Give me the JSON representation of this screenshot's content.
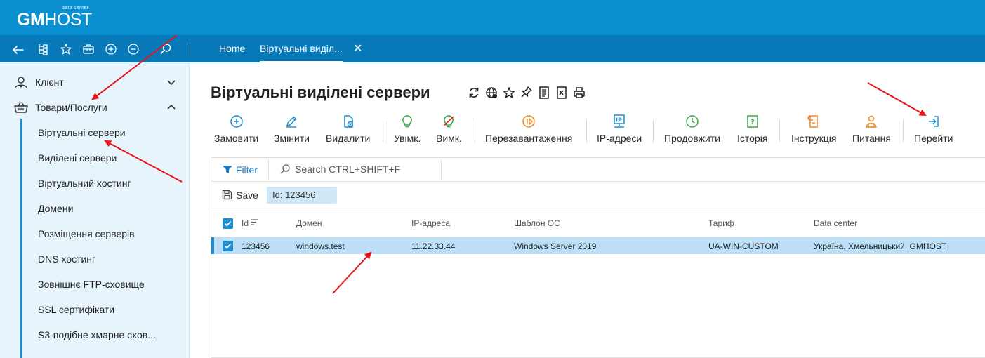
{
  "brand": {
    "logo_bold": "GM",
    "logo_light": "HOST",
    "tagline": "data center"
  },
  "navbar": {
    "icons": [
      "back-arrow-icon",
      "tree-icon",
      "star-icon",
      "briefcase-icon",
      "plus-circle-icon",
      "minus-circle-icon",
      "search-icon"
    ],
    "tabs": [
      {
        "label": "Home"
      },
      {
        "label": "Віртуальні виділ..."
      }
    ],
    "close_label": "✕"
  },
  "sidebar": {
    "groups": [
      {
        "label": "Клієнт",
        "icon": "user-icon",
        "expanded": false
      },
      {
        "label": "Товари/Послуги",
        "icon": "basket-icon",
        "expanded": true
      }
    ],
    "items": [
      "Віртуальні сервери",
      "Виділені сервери",
      "Віртуальний хостинг",
      "Домени",
      "Розміщення серверів",
      "DNS хостинг",
      "Зовнішнє FTP-сховище",
      "SSL сертифікати",
      "S3-подібне хмарне схов..."
    ]
  },
  "page": {
    "title": "Віртуальні виділені сервери",
    "title_icons": [
      "refresh-icon",
      "globe-icon",
      "star-icon",
      "pin-icon",
      "document-icon",
      "excel-icon",
      "print-icon"
    ]
  },
  "toolbar": [
    {
      "label": "Замовити",
      "icon": "plus-circle-icon",
      "color": "#1d8fd1"
    },
    {
      "label": "Змінити",
      "icon": "pencil-icon",
      "color": "#1d8fd1"
    },
    {
      "label": "Видалити",
      "icon": "delete-doc-icon",
      "color": "#1d8fd1"
    },
    {
      "label": "Увімк.",
      "icon": "bulb-on-icon",
      "color": "#3aa647"
    },
    {
      "label": "Вимк.",
      "icon": "bulb-off-icon",
      "color": "#3aa647"
    },
    {
      "label": "Перезавантаження",
      "icon": "restart-icon",
      "color": "#f08a24"
    },
    {
      "label": "IP-адреси",
      "icon": "ip-icon",
      "color": "#1d8fd1"
    },
    {
      "label": "Продовжити",
      "icon": "clock-icon",
      "color": "#3aa647"
    },
    {
      "label": "Історія",
      "icon": "history-icon",
      "color": "#3aa647"
    },
    {
      "label": "Інструкція",
      "icon": "manual-icon",
      "color": "#f08a24"
    },
    {
      "label": "Питання",
      "icon": "support-icon",
      "color": "#f08a24"
    },
    {
      "label": "Перейти",
      "icon": "enter-icon",
      "color": "#1d8fd1"
    }
  ],
  "filter": {
    "label": "Filter",
    "search_placeholder": "Search CTRL+SHIFT+F"
  },
  "save": {
    "label": "Save",
    "id_filter": "Id: 123456"
  },
  "table": {
    "columns": [
      "Id",
      "Домен",
      "IP-адреса",
      "Шаблон ОС",
      "Тариф",
      "Data center"
    ],
    "rows": [
      {
        "id": "123456",
        "domain": "windows.test",
        "ip": "11.22.33.44",
        "os": "Windows Server 2019",
        "tariff": "UA-WIN-CUSTOM",
        "datacenter": "Україна, Хмельницький, GMHOST",
        "selected": true
      }
    ]
  },
  "colors": {
    "header": "#0a8fd0",
    "navbar": "#0778b8",
    "accent": "#1d8fd1",
    "selected_row": "#bcdff7",
    "annotation": "#e8141b"
  }
}
